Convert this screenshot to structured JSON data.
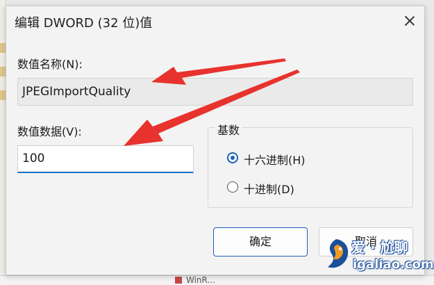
{
  "dialog": {
    "title": "编辑 DWORD (32 位)值",
    "value_name_label": "数值名称(N):",
    "value_name": "JPEGImportQuality",
    "value_data_label": "数值数据(V):",
    "value_data": "100",
    "base": {
      "title": "基数",
      "options": [
        {
          "label": "十六进制(H)",
          "selected": true
        },
        {
          "label": "十进制(D)",
          "selected": false
        }
      ]
    },
    "ok_label": "确定",
    "cancel_label": "取消"
  },
  "background": {
    "bottom_text": "WinR..."
  },
  "watermark": {
    "text_cn": "爱 · 尬聊",
    "text_url": "igaliao.com"
  },
  "colors": {
    "accent": "#1a5fb4",
    "arrow": "#e8322e"
  },
  "icons": {
    "close": "close-icon",
    "annotation_arrows": "arrow-annotation-icon"
  }
}
